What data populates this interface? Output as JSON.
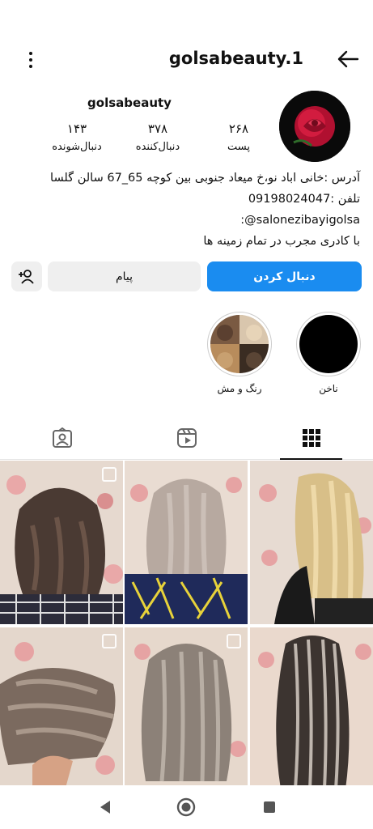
{
  "header": {
    "title": "golsabeauty.1",
    "menu_icon": "more-vertical-icon",
    "back_icon": "arrow-left-icon"
  },
  "profile": {
    "username": "golsabeauty",
    "avatar": "rose-avatar",
    "stats": {
      "posts_count": "۲۶۸",
      "posts_label": "پست",
      "followers_count": "۳۷۸",
      "followers_label": "دنبال‌کننده",
      "following_count": "۱۴۳",
      "following_label": "دنبال‌شونده"
    },
    "bio": {
      "line1": "آدرس  :خانی اباد نو،خ میعاد جنوبی بین کوچه 65_67 سالن گلسا",
      "line2": "تلفن  :09198024047",
      "line3": "salonezibayigolsa@:",
      "line4": "با کادری مجرب در تمام زمینه ها"
    }
  },
  "actions": {
    "follow_label": "دنبال کردن",
    "message_label": "پیام",
    "add_user_icon": "add-user-icon"
  },
  "highlights": [
    {
      "label": "ناخن"
    },
    {
      "label": "رنگ و مش"
    }
  ],
  "tabs": {
    "grid_icon": "grid-icon",
    "reels_icon": "reels-icon",
    "tagged_icon": "tagged-icon"
  },
  "colors": {
    "accent": "#1a8cf0",
    "secondary_button": "#efefef"
  },
  "navbar": {
    "back_icon": "triangle-back-icon",
    "home_icon": "circle-home-icon",
    "recents_icon": "square-recents-icon"
  }
}
